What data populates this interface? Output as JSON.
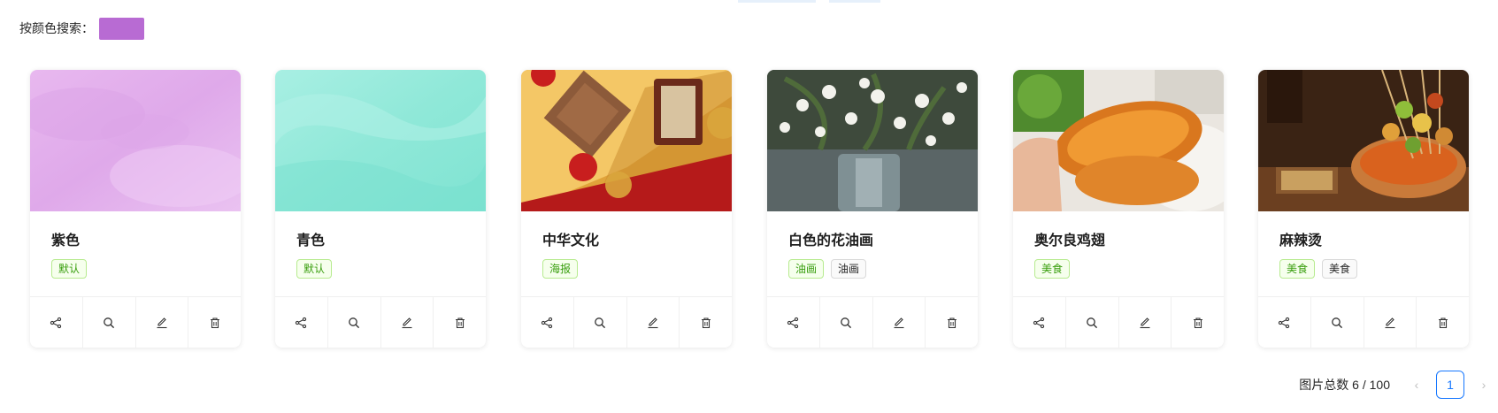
{
  "search": {
    "label": "按颜色搜索：",
    "color": "#b86bd3"
  },
  "action_icons": [
    "share-icon",
    "search-icon",
    "edit-icon",
    "delete-icon"
  ],
  "cards": [
    {
      "title": "紫色",
      "tags": [
        {
          "text": "默认",
          "style": "green"
        }
      ],
      "cover": "purple watercolor"
    },
    {
      "title": "青色",
      "tags": [
        {
          "text": "默认",
          "style": "green"
        }
      ],
      "cover": "cyan watercolor"
    },
    {
      "title": "中华文化",
      "tags": [
        {
          "text": "海报",
          "style": "green"
        }
      ],
      "cover": "chinese culture items"
    },
    {
      "title": "白色的花油画",
      "tags": [
        {
          "text": "油画",
          "style": "green"
        },
        {
          "text": "油画",
          "style": "default"
        }
      ],
      "cover": "white flowers oil painting"
    },
    {
      "title": "奥尔良鸡翅",
      "tags": [
        {
          "text": "美食",
          "style": "green"
        }
      ],
      "cover": "orleans chicken wings"
    },
    {
      "title": "麻辣烫",
      "tags": [
        {
          "text": "美食",
          "style": "green"
        },
        {
          "text": "美食",
          "style": "default"
        }
      ],
      "cover": "malatang skewers"
    }
  ],
  "pagination": {
    "total_text": "图片总数 6 / 100",
    "current": "1",
    "prev": "‹",
    "next": "›"
  },
  "colors": {
    "primary": "#1677ff",
    "tag_green": "#389e0d"
  }
}
